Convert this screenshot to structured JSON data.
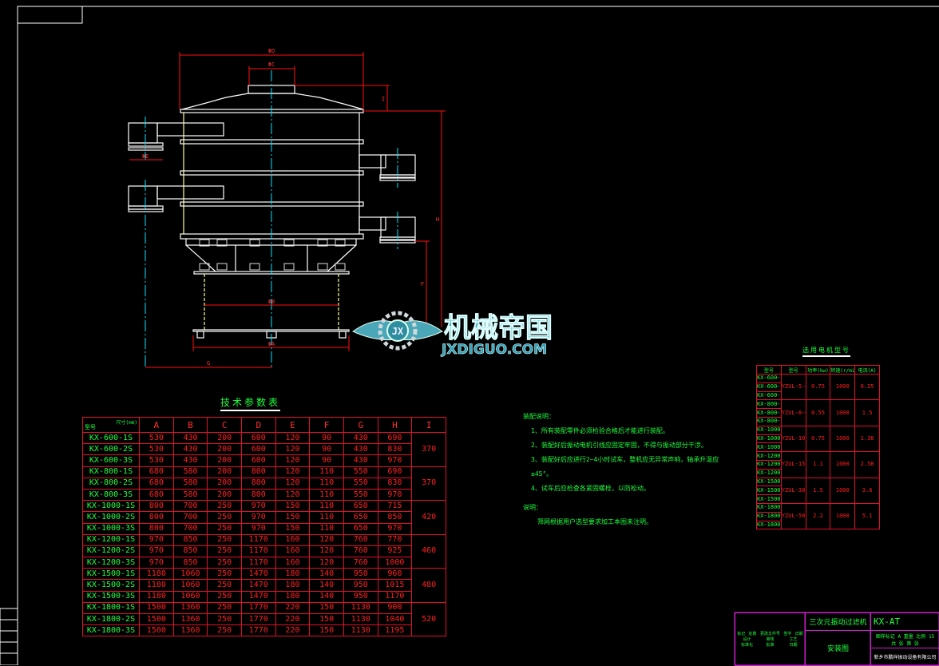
{
  "drawing": {
    "dimensions": {
      "outer_dia": "ΦD",
      "cap_dia": "ΦC",
      "cap_height": "I",
      "total_height": "H",
      "outlet_dia": "ΦE",
      "leg_dia": "ΦB",
      "base_dia": "ΦA",
      "outlet_offset": "G",
      "base_height": "F"
    },
    "watermark": {
      "cn": "机械帝国",
      "en": "JXDIGUO.COM",
      "badge": "JX"
    },
    "colors": {
      "background": "#000000",
      "line": "#ffffff",
      "dimension": "#ff0000",
      "centerline": "#00e5ff",
      "text": "#20ff40",
      "titleblock": "#d020d0"
    }
  },
  "tech_table": {
    "title": "技术参数表",
    "corner_left": "型号",
    "corner_right": "尺寸(mm)",
    "headers": [
      "A",
      "B",
      "C",
      "D",
      "E",
      "F",
      "G",
      "H",
      "I"
    ],
    "groups": [
      {
        "i": "370",
        "rows": [
          {
            "model": "KX-600-1S",
            "v": [
              "530",
              "430",
              "200",
              "600",
              "120",
              "90",
              "430",
              "690"
            ]
          },
          {
            "model": "KX-600-2S",
            "v": [
              "530",
              "430",
              "200",
              "600",
              "120",
              "90",
              "430",
              "830"
            ]
          },
          {
            "model": "KX-600-3S",
            "v": [
              "530",
              "430",
              "200",
              "600",
              "120",
              "90",
              "430",
              "970"
            ]
          }
        ]
      },
      {
        "i": "370",
        "rows": [
          {
            "model": "KX-800-1S",
            "v": [
              "680",
              "580",
              "200",
              "800",
              "120",
              "110",
              "550",
              "690"
            ]
          },
          {
            "model": "KX-800-2S",
            "v": [
              "680",
              "580",
              "200",
              "800",
              "120",
              "110",
              "550",
              "830"
            ]
          },
          {
            "model": "KX-800-3S",
            "v": [
              "680",
              "580",
              "200",
              "800",
              "120",
              "110",
              "550",
              "970"
            ]
          }
        ]
      },
      {
        "i": "420",
        "rows": [
          {
            "model": "KX-1000-1S",
            "v": [
              "800",
              "700",
              "250",
              "970",
              "150",
              "110",
              "650",
              "715"
            ]
          },
          {
            "model": "KX-1000-2S",
            "v": [
              "800",
              "700",
              "250",
              "970",
              "150",
              "110",
              "650",
              "850"
            ]
          },
          {
            "model": "KX-1000-3S",
            "v": [
              "800",
              "700",
              "250",
              "970",
              "150",
              "110",
              "650",
              "970"
            ]
          }
        ]
      },
      {
        "i": "460",
        "rows": [
          {
            "model": "KX-1200-1S",
            "v": [
              "970",
              "850",
              "250",
              "1170",
              "160",
              "120",
              "760",
              "770"
            ]
          },
          {
            "model": "KX-1200-2S",
            "v": [
              "970",
              "850",
              "250",
              "1170",
              "160",
              "120",
              "760",
              "925"
            ]
          },
          {
            "model": "KX-1200-3S",
            "v": [
              "970",
              "850",
              "250",
              "1170",
              "160",
              "120",
              "760",
              "1000"
            ]
          }
        ]
      },
      {
        "i": "480",
        "rows": [
          {
            "model": "KX-1500-1S",
            "v": [
              "1180",
              "1060",
              "250",
              "1470",
              "180",
              "140",
              "950",
              "960"
            ]
          },
          {
            "model": "KX-1500-2S",
            "v": [
              "1180",
              "1060",
              "250",
              "1470",
              "180",
              "140",
              "950",
              "1015"
            ]
          },
          {
            "model": "KX-1500-3S",
            "v": [
              "1180",
              "1060",
              "250",
              "1470",
              "180",
              "140",
              "950",
              "1170"
            ]
          }
        ]
      },
      {
        "i": "520",
        "rows": [
          {
            "model": "KX-1800-1S",
            "v": [
              "1500",
              "1360",
              "250",
              "1770",
              "220",
              "150",
              "1130",
              "900"
            ]
          },
          {
            "model": "KX-1800-2S",
            "v": [
              "1500",
              "1360",
              "250",
              "1770",
              "220",
              "150",
              "1130",
              "1040"
            ]
          },
          {
            "model": "KX-1800-3S",
            "v": [
              "1500",
              "1360",
              "250",
              "1770",
              "220",
              "150",
              "1130",
              "1195"
            ]
          }
        ]
      }
    ]
  },
  "motor_table": {
    "title": "选用电机型号",
    "headers": [
      "型号",
      "型号",
      "功率(kw)",
      "转速(r/min)",
      "电流(A)"
    ],
    "groups": [
      {
        "motor": "YZUL-5-6",
        "power": "0.75",
        "speed": "1000",
        "current": "0.25",
        "models": [
          "KX-600-1S",
          "KX-600-2S",
          "KX-600-3S"
        ]
      },
      {
        "motor": "YZUL-8-6",
        "power": "0.55",
        "speed": "1000",
        "current": "1.5",
        "models": [
          "KX-800-1S",
          "KX-800-2S",
          "KX-800-3S"
        ]
      },
      {
        "motor": "YZUL-10-6",
        "power": "0.75",
        "speed": "1000",
        "current": "1.38",
        "models": [
          "KX-1000-1S",
          "KX-1000-2S",
          "KX-1000-3S"
        ]
      },
      {
        "motor": "YZUL-15-6",
        "power": "1.1",
        "speed": "1000",
        "current": "2.58",
        "models": [
          "KX-1200-1S",
          "KX-1200-2S",
          "KX-1200-3S"
        ]
      },
      {
        "motor": "YZUL-30-6",
        "power": "1.5",
        "speed": "1000",
        "current": "3.6",
        "models": [
          "KX-1500-1S",
          "KX-1500-2S",
          "KX-1500-3S"
        ]
      },
      {
        "motor": "YZUL-50-6",
        "power": "2.2",
        "speed": "1000",
        "current": "5.1",
        "models": [
          "KX-1800-1S",
          "KX-1800-2S",
          "KX-1800-3S"
        ]
      }
    ]
  },
  "notes": {
    "assembly_title": "装配说明：",
    "assembly": [
      "1、所有装配零件必须检验合格后才能进行装配。",
      "2、装配好后振动电机引线应固定牢固，不得与振动部分干涉。",
      "3、装配好后应进行2~4小时试车，整机应无异常声响，轴承升温应≤45°。",
      "4、试车后应检查各紧固螺栓，以防松动。"
    ],
    "remark_title": "说明：",
    "remark": "筛网根据用户选型要求加工本图未注明。"
  },
  "title_block": {
    "product": "三次元振动过滤机",
    "drawing_type": "安装图",
    "code": "KX-AT",
    "company": "新乡市鹏祥振动设备有限公司",
    "stage_label": "图样标记",
    "weight_label": "重量",
    "scale_label": "比例",
    "stage": "A",
    "scale": "15",
    "sheets_label": "共 张",
    "sheet_label": "第 张",
    "rev_headers": [
      "标记",
      "处数",
      "更改文件号",
      "签字",
      "日期"
    ],
    "roles": [
      "设计",
      "审核",
      "工艺",
      "标准化",
      "批准",
      "日期"
    ]
  }
}
